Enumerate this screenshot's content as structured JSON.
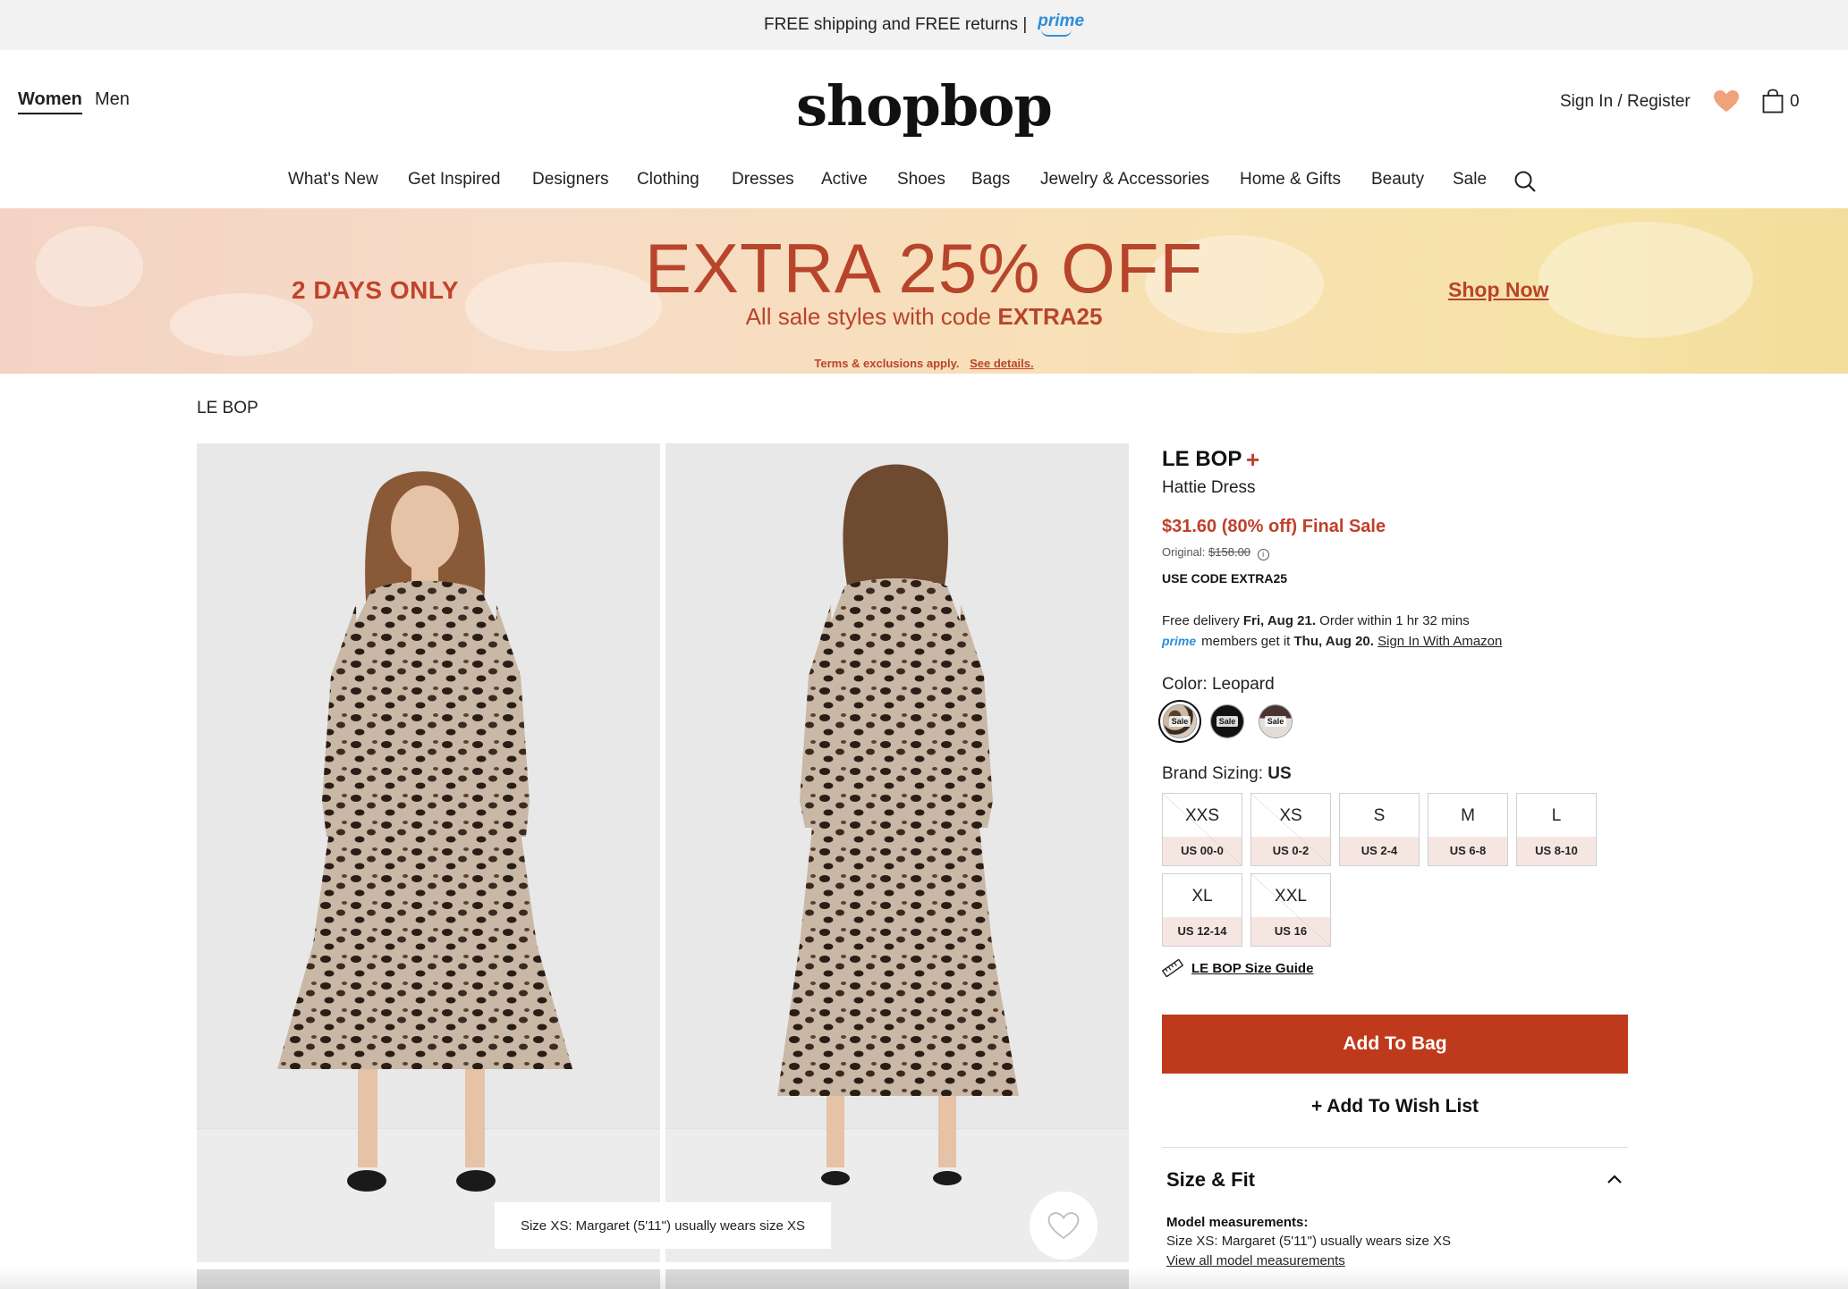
{
  "promo_bar": {
    "text": "FREE shipping and FREE returns |",
    "prime_logo": "prime"
  },
  "header": {
    "gender_tabs": [
      {
        "label": "Women",
        "active": true
      },
      {
        "label": "Men",
        "active": false
      }
    ],
    "logo": "shopbop",
    "sign_in": "Sign In / Register",
    "bag_count": "0",
    "icons": {
      "wishlist": "heart-icon",
      "bag": "shopping-bag-icon",
      "search": "search-icon"
    },
    "heart_color": "#f0a27a"
  },
  "nav": {
    "items": [
      "What's New",
      "Get Inspired",
      "Designers",
      "Clothing",
      "Dresses",
      "Active",
      "Shoes",
      "Bags",
      "Jewelry & Accessories",
      "Home & Gifts",
      "Beauty",
      "Sale"
    ]
  },
  "banner": {
    "days": "2 DAYS ONLY",
    "headline": "EXTRA 25% OFF",
    "subtitle_prefix": "All sale styles with code",
    "code": "EXTRA25",
    "terms": "Terms & exclusions apply.",
    "see_details": "See details.",
    "cta": "Shop Now",
    "accent_color": "#b8442c"
  },
  "breadcrumb": "LE BOP",
  "gallery": {
    "model_note": "Size XS: Margaret (5'11\") usually wears size XS"
  },
  "product": {
    "brand": "LE BOP",
    "brand_plus": "+",
    "name": "Hattie Dress",
    "price": "$31.60 (80% off) Final Sale",
    "original_label": "Original:",
    "original_price": "$158.00",
    "use_code": "USE CODE EXTRA25",
    "delivery_prefix": "Free delivery",
    "delivery_date": "Fri, Aug 21.",
    "delivery_suffix": "Order within 1 hr 32 mins",
    "prime_small": "prime",
    "prime_members": "members get it",
    "prime_date": "Thu, Aug 20.",
    "prime_link": "Sign In With Amazon",
    "color_label": "Color:",
    "color_value": "Leopard",
    "swatches": [
      {
        "tag": "Sale",
        "selected": true
      },
      {
        "tag": "Sale",
        "selected": false
      },
      {
        "tag": "Sale",
        "selected": false
      }
    ],
    "sizing_label": "Brand Sizing:",
    "sizing_value": "US",
    "sizes": [
      {
        "size": "XXS",
        "us": "US 00-0",
        "out_of_stock": true
      },
      {
        "size": "XS",
        "us": "US 0-2",
        "out_of_stock": true
      },
      {
        "size": "S",
        "us": "US 2-4",
        "out_of_stock": false
      },
      {
        "size": "M",
        "us": "US 6-8",
        "out_of_stock": false
      },
      {
        "size": "L",
        "us": "US 8-10",
        "out_of_stock": false
      },
      {
        "size": "XL",
        "us": "US 12-14",
        "out_of_stock": false
      },
      {
        "size": "XXL",
        "us": "US 16",
        "out_of_stock": true
      }
    ],
    "size_guide": "LE BOP Size Guide",
    "add_to_bag": "Add To Bag",
    "add_to_wishlist": "+ Add To Wish List",
    "button_color": "#bf3a1c",
    "price_color": "#c0402a"
  },
  "size_fit": {
    "title": "Size & Fit",
    "model_measurements_title": "Model measurements:",
    "model_measurements_text": "Size XS: Margaret (5'11\") usually wears size XS",
    "view_all": "View all model measurements"
  }
}
